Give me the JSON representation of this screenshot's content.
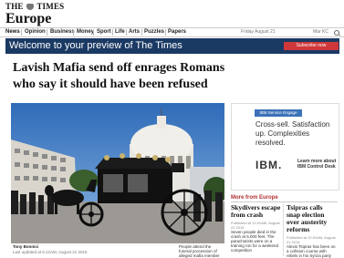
{
  "masthead": {
    "logo_text_1": "THE",
    "logo_text_2": "TIMES",
    "section": "Europe"
  },
  "nav": {
    "items": [
      "News",
      "Opinion",
      "Business",
      "Money",
      "Sport",
      "Life",
      "Arts",
      "Puzzles",
      "Papers"
    ],
    "date": "Friday August 21",
    "more": "Mar KC"
  },
  "welcome": {
    "text": "Welcome to your preview of The Times",
    "subscribe": "Subscribe now"
  },
  "article": {
    "headline": "Lavish Mafia send off enrages Romans who say it should have been refused",
    "photo_author": "Tony Bonnici",
    "updated": "Last updated at 6:12AM, August 21 2015",
    "photo_caption": "People attend the funeral procession of alleged mafia member"
  },
  "ad": {
    "badge": "IBM Service Engage",
    "copy": "Cross-sell. Satisfaction up. Complexities resolved.",
    "logo": "IBM.",
    "learn": "Learn more about IBM Control Desk"
  },
  "more_from": {
    "heading": "More from Europe",
    "stories": [
      {
        "title": "Skydivers escape from crash",
        "time": "Published at 12:01AM, August 21 2015",
        "body": "Seven people died in the crash at 5,000 feet. The parachutists were on a training run for a weekend competition"
      },
      {
        "title": "Tsipras calls snap election over austerity reforms",
        "time": "Published at 12:01AM, August 21 2015",
        "body": "Alexis Tsipras has been on a collision course with rebels in his Syriza party"
      }
    ]
  },
  "colors": {
    "welcome_bg": "#1a3a63",
    "subscribe_bg": "#d0373a",
    "ad_badge_bg": "#3c72b8",
    "more_from": "#b03030"
  }
}
